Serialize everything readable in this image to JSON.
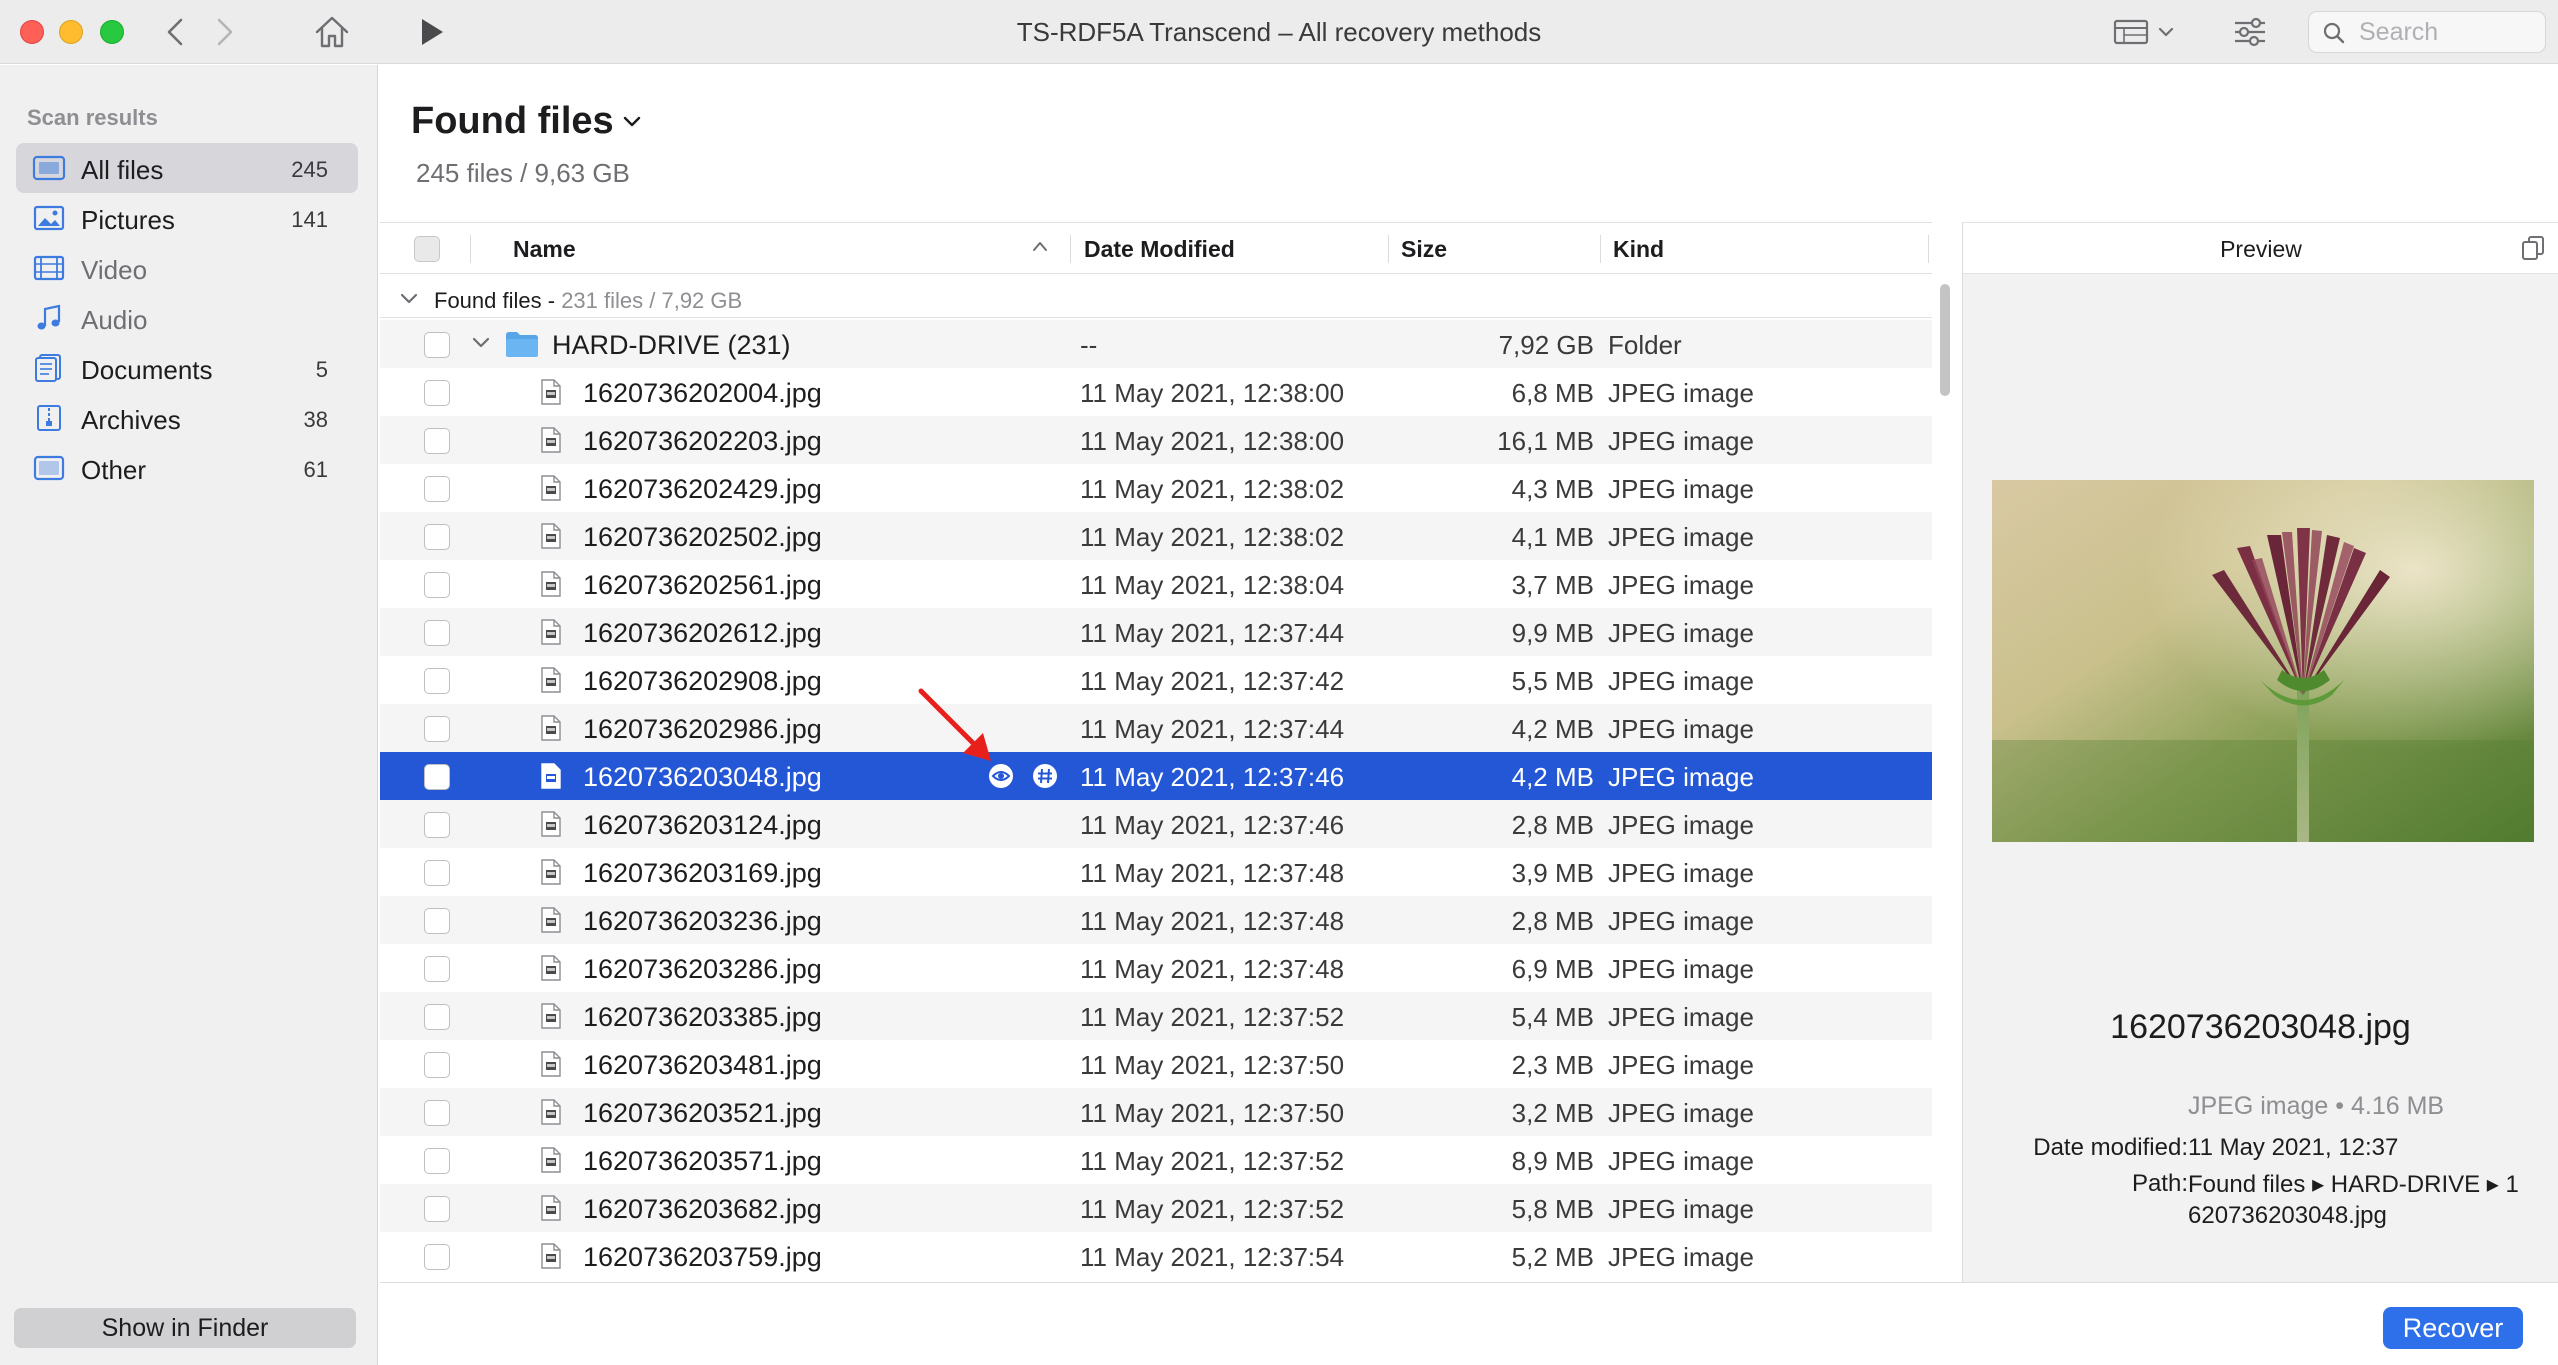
{
  "window": {
    "title": "TS-RDF5A Transcend – All recovery methods",
    "search_placeholder": "Search",
    "toolbar_icons": [
      "back-icon",
      "forward-icon",
      "home-icon",
      "play-icon",
      "view-mode-icon",
      "filter-settings-icon",
      "search-icon"
    ]
  },
  "sidebar": {
    "section_title": "Scan results",
    "items": [
      {
        "label": "All files",
        "count": "245",
        "icon": "all-files-icon",
        "active": true
      },
      {
        "label": "Pictures",
        "count": "141",
        "icon": "pictures-icon"
      },
      {
        "label": "Video",
        "count": "",
        "icon": "video-icon"
      },
      {
        "label": "Audio",
        "count": "",
        "icon": "audio-icon"
      },
      {
        "label": "Documents",
        "count": "5",
        "icon": "documents-icon"
      },
      {
        "label": "Archives",
        "count": "38",
        "icon": "archives-icon"
      },
      {
        "label": "Other",
        "count": "61",
        "icon": "other-icon"
      }
    ],
    "show_in_finder": "Show in Finder"
  },
  "header": {
    "title": "Found files",
    "subtitle": "245 files / 9,63 GB"
  },
  "table": {
    "columns": {
      "name": "Name",
      "date": "Date Modified",
      "size": "Size",
      "kind": "Kind"
    },
    "group": {
      "label": "Found files -",
      "meta": "231 files / 7,92 GB"
    },
    "folder": {
      "name": "HARD-DRIVE (231)",
      "date": "--",
      "size": "7,92 GB",
      "kind": "Folder"
    },
    "rows": [
      {
        "name": "1620736202004.jpg",
        "date": "11 May 2021, 12:38:00",
        "size": "6,8 MB",
        "kind": "JPEG image"
      },
      {
        "name": "1620736202203.jpg",
        "date": "11 May 2021, 12:38:00",
        "size": "16,1 MB",
        "kind": "JPEG image"
      },
      {
        "name": "1620736202429.jpg",
        "date": "11 May 2021, 12:38:02",
        "size": "4,3 MB",
        "kind": "JPEG image"
      },
      {
        "name": "1620736202502.jpg",
        "date": "11 May 2021, 12:38:02",
        "size": "4,1 MB",
        "kind": "JPEG image"
      },
      {
        "name": "1620736202561.jpg",
        "date": "11 May 2021, 12:38:04",
        "size": "3,7 MB",
        "kind": "JPEG image"
      },
      {
        "name": "1620736202612.jpg",
        "date": "11 May 2021, 12:37:44",
        "size": "9,9 MB",
        "kind": "JPEG image"
      },
      {
        "name": "1620736202908.jpg",
        "date": "11 May 2021, 12:37:42",
        "size": "5,5 MB",
        "kind": "JPEG image"
      },
      {
        "name": "1620736202986.jpg",
        "date": "11 May 2021, 12:37:44",
        "size": "4,2 MB",
        "kind": "JPEG image"
      },
      {
        "name": "1620736203048.jpg",
        "date": "11 May 2021, 12:37:46",
        "size": "4,2 MB",
        "kind": "JPEG image",
        "selected": true
      },
      {
        "name": "1620736203124.jpg",
        "date": "11 May 2021, 12:37:46",
        "size": "2,8 MB",
        "kind": "JPEG image"
      },
      {
        "name": "1620736203169.jpg",
        "date": "11 May 2021, 12:37:48",
        "size": "3,9 MB",
        "kind": "JPEG image"
      },
      {
        "name": "1620736203236.jpg",
        "date": "11 May 2021, 12:37:48",
        "size": "2,8 MB",
        "kind": "JPEG image"
      },
      {
        "name": "1620736203286.jpg",
        "date": "11 May 2021, 12:37:48",
        "size": "6,9 MB",
        "kind": "JPEG image"
      },
      {
        "name": "1620736203385.jpg",
        "date": "11 May 2021, 12:37:52",
        "size": "5,4 MB",
        "kind": "JPEG image"
      },
      {
        "name": "1620736203481.jpg",
        "date": "11 May 2021, 12:37:50",
        "size": "2,3 MB",
        "kind": "JPEG image"
      },
      {
        "name": "1620736203521.jpg",
        "date": "11 May 2021, 12:37:50",
        "size": "3,2 MB",
        "kind": "JPEG image"
      },
      {
        "name": "1620736203571.jpg",
        "date": "11 May 2021, 12:37:52",
        "size": "8,9 MB",
        "kind": "JPEG image"
      },
      {
        "name": "1620736203682.jpg",
        "date": "11 May 2021, 12:37:52",
        "size": "5,8 MB",
        "kind": "JPEG image"
      },
      {
        "name": "1620736203759.jpg",
        "date": "11 May 2021, 12:37:54",
        "size": "5,2 MB",
        "kind": "JPEG image"
      }
    ]
  },
  "preview": {
    "title": "Preview",
    "file_name": "1620736203048.jpg",
    "kind_size": "JPEG image • 4.16 MB",
    "date_label": "Date modified:",
    "date_value": "11 May 2021, 12:37",
    "path_label": "Path:",
    "path_value_line1": "Found files ▸ HARD-DRIVE ▸ 1",
    "path_value_line2": "620736203048.jpg"
  },
  "footer": {
    "recover_label": "Recover"
  },
  "colors": {
    "accent": "#2e6fea",
    "selection": "#2357d6",
    "sidebar_bg": "#f0f0f0",
    "annotation_arrow": "#e8201c"
  }
}
